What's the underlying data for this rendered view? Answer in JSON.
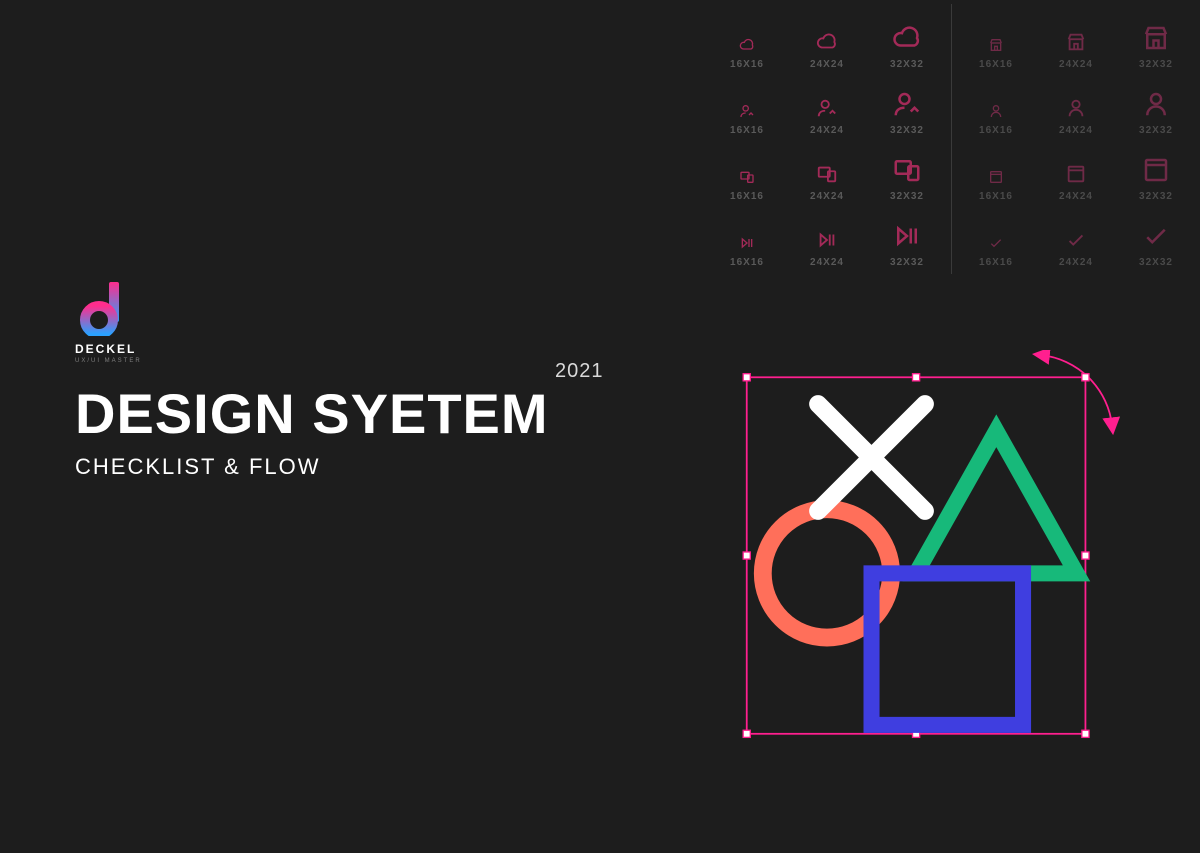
{
  "brand": {
    "name": "DECKEL",
    "tagline": "UX/UI  MASTER"
  },
  "hero": {
    "year": "2021",
    "headline": "DESIGN SYETEM",
    "subhead": "CHECKLIST & FLOW"
  },
  "icon_sizes": [
    "16X16",
    "24X24",
    "32X32"
  ],
  "icon_grid_left": {
    "rows": [
      {
        "name": "cloud-icon"
      },
      {
        "name": "user-check-icon"
      },
      {
        "name": "devices-icon"
      },
      {
        "name": "play-pause-icon"
      }
    ]
  },
  "icon_grid_right": {
    "rows": [
      {
        "name": "storefront-icon"
      },
      {
        "name": "person-icon"
      },
      {
        "name": "window-icon"
      },
      {
        "name": "check-icon"
      }
    ]
  },
  "artwork": {
    "selection_color": "#ff1f8f",
    "cross_color": "#ffffff",
    "triangle_color": "#17b97a",
    "circle_color": "#ff6f5a",
    "square_color": "#3f3ee0"
  }
}
